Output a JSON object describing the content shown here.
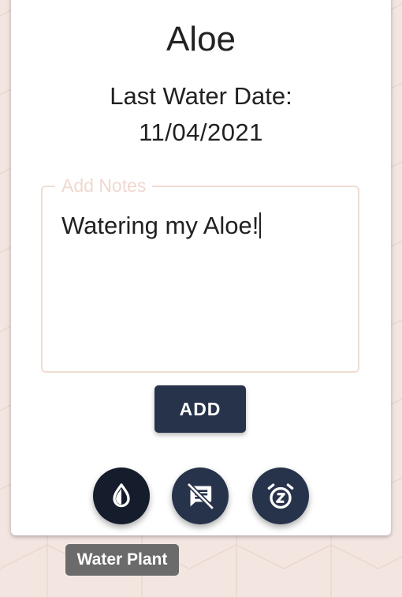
{
  "plant": {
    "name": "Aloe",
    "last_water_label": "Last Water Date:",
    "last_water_date": "11/04/2021"
  },
  "notes": {
    "label": "Add Notes",
    "value": "Watering my Aloe!"
  },
  "actions": {
    "add_label": "ADD",
    "water_icon": "water-drop-icon",
    "notes_icon": "comment-off-icon",
    "snooze_icon": "snooze-alarm-icon"
  },
  "tooltip": {
    "text": "Water Plant"
  },
  "colors": {
    "primary": "#27334a",
    "background": "#f3e6e1",
    "notes_border": "#f1dcd3"
  }
}
